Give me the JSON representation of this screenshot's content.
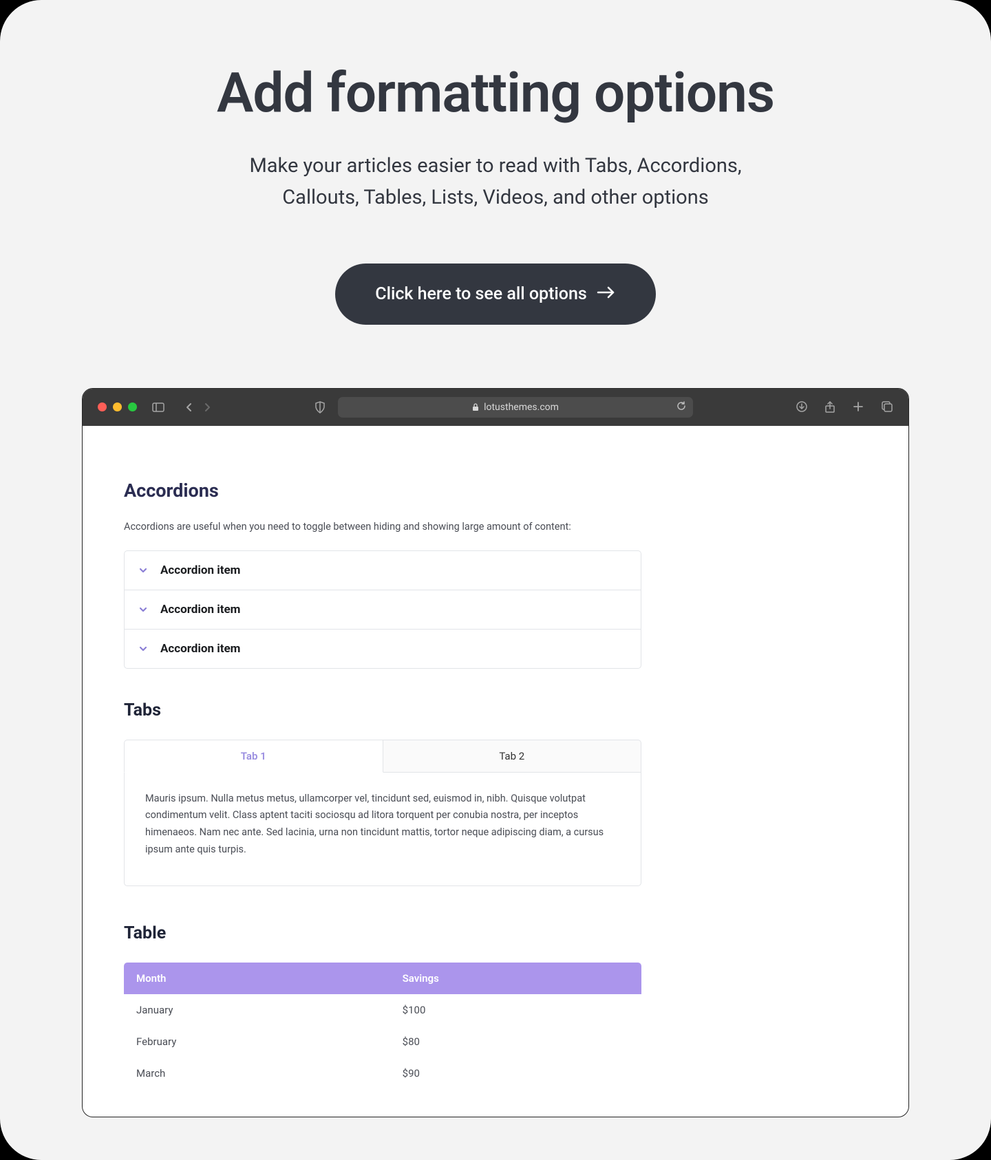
{
  "hero": {
    "title": "Add formatting options",
    "subtitle": "Make your articles easier to read with Tabs, Accordions, Callouts, Tables, Lists, Videos, and other options",
    "cta_label": "Click here to see all options"
  },
  "browser": {
    "url": "lotusthemes.com"
  },
  "sections": {
    "accordions": {
      "title": "Accordions",
      "description": "Accordions are useful when you need to toggle between hiding and showing large amount of content:",
      "items": [
        {
          "label": "Accordion item"
        },
        {
          "label": "Accordion item"
        },
        {
          "label": "Accordion item"
        }
      ]
    },
    "tabs": {
      "title": "Tabs",
      "headers": [
        {
          "label": "Tab 1",
          "active": true
        },
        {
          "label": "Tab 2",
          "active": false
        }
      ],
      "content": "Mauris ipsum. Nulla metus metus, ullamcorper vel, tincidunt sed, euismod in, nibh. Quisque volutpat condimentum velit. Class aptent taciti sociosqu ad litora torquent per conubia nostra, per inceptos himenaeos. Nam nec ante. Sed lacinia, urna non tincidunt mattis, tortor neque adipiscing diam, a cursus ipsum ante quis turpis."
    },
    "table": {
      "title": "Table",
      "headers": [
        "Month",
        "Savings"
      ],
      "rows": [
        [
          "January",
          "$100"
        ],
        [
          "February",
          "$80"
        ],
        [
          "March",
          "$90"
        ]
      ]
    }
  },
  "colors": {
    "accent_purple": "#ab95ec",
    "dark": "#333740",
    "heading_navy": "#2b2d52"
  }
}
